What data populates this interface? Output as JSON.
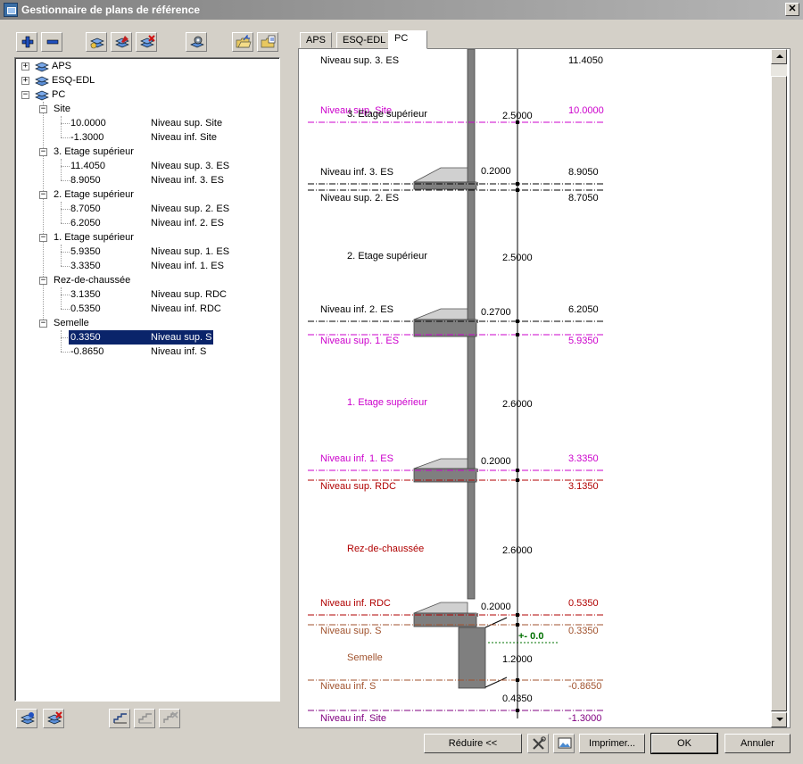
{
  "window": {
    "title": "Gestionnaire de plans de référence"
  },
  "toolbar": {
    "buttons": [
      "add-icon",
      "remove-icon",
      "layers-icon",
      "layers-edit-icon",
      "layers-delete-icon",
      "settings-icon",
      "folder-open-icon",
      "folder-export-icon"
    ]
  },
  "tree": {
    "projects": [
      "APS",
      "ESQ-EDL",
      "PC"
    ],
    "groups": [
      {
        "name": "Site",
        "rows": [
          {
            "value": "10.0000",
            "label": "Niveau sup. Site"
          },
          {
            "value": "-1.3000",
            "label": "Niveau inf. Site"
          }
        ]
      },
      {
        "name": "3. Etage supérieur",
        "rows": [
          {
            "value": "11.4050",
            "label": "Niveau sup. 3. ES"
          },
          {
            "value": "8.9050",
            "label": "Niveau inf. 3. ES"
          }
        ]
      },
      {
        "name": "2. Etage supérieur",
        "rows": [
          {
            "value": "8.7050",
            "label": "Niveau sup. 2. ES"
          },
          {
            "value": "6.2050",
            "label": "Niveau inf. 2. ES"
          }
        ]
      },
      {
        "name": "1. Etage supérieur",
        "rows": [
          {
            "value": "5.9350",
            "label": "Niveau sup. 1. ES"
          },
          {
            "value": "3.3350",
            "label": "Niveau inf. 1. ES"
          }
        ]
      },
      {
        "name": "Rez-de-chaussée",
        "rows": [
          {
            "value": "3.1350",
            "label": "Niveau sup. RDC"
          },
          {
            "value": "0.5350",
            "label": "Niveau inf. RDC"
          }
        ]
      },
      {
        "name": "Semelle",
        "rows": [
          {
            "value": "0.3350",
            "label": "Niveau sup. S"
          },
          {
            "value": "-0.8650",
            "label": "Niveau inf. S"
          }
        ]
      }
    ]
  },
  "tabs": [
    "APS",
    "ESQ-EDL",
    "PC"
  ],
  "active_tab": "PC",
  "diagram": {
    "colors": {
      "black": "#000000",
      "magenta": "#cc00cc",
      "red": "#b00000",
      "brown": "#a0522d",
      "purple": "#800080",
      "green": "#007000",
      "wall": "#7f7f7f",
      "slab_top": "#d0d0d0"
    },
    "top_label": {
      "left": "Niveau sup. 3. ES",
      "right": "11.4050"
    },
    "levels": [
      {
        "name": "Niveau sup. Site",
        "value": "10.0000",
        "color": "magenta"
      },
      {
        "name": "Niveau inf. 3. ES",
        "value": "8.9050",
        "color": "black"
      },
      {
        "name": "Niveau sup. 2. ES",
        "value": "8.7050",
        "color": "black"
      },
      {
        "name": "Niveau inf. 2. ES",
        "value": "6.2050",
        "color": "black"
      },
      {
        "name": "Niveau sup. 1. ES",
        "value": "5.9350",
        "color": "magenta"
      },
      {
        "name": "Niveau inf. 1. ES",
        "value": "3.3350",
        "color": "magenta"
      },
      {
        "name": "Niveau sup. RDC",
        "value": "3.1350",
        "color": "red"
      },
      {
        "name": "Niveau inf. RDC",
        "value": "0.5350",
        "color": "red"
      },
      {
        "name": "Niveau sup. S",
        "value": "0.3350",
        "color": "brown"
      },
      {
        "name": "Niveau inf. S",
        "value": "-0.8650",
        "color": "brown"
      },
      {
        "name": "Niveau inf. Site",
        "value": "-1.3000",
        "color": "purple"
      }
    ],
    "storeys": [
      {
        "name": "3. Etage supérieur",
        "height": "2.5000",
        "color": "black"
      },
      {
        "name": "2. Etage supérieur",
        "height": "2.5000",
        "color": "black"
      },
      {
        "name": "1. Etage supérieur",
        "height": "2.6000",
        "color": "magenta"
      },
      {
        "name": "Rez-de-chaussée",
        "height": "2.6000",
        "color": "red"
      },
      {
        "name": "Semelle",
        "height": "1.2000",
        "color": "brown"
      }
    ],
    "slab_thicknesses": [
      "0.2000",
      "0.2700",
      "0.2000",
      "0.2000"
    ],
    "foundation_gap": "0.4350",
    "zero_label": "+- 0.0"
  },
  "buttons": {
    "reduce": "Réduire <<",
    "print": "Imprimer...",
    "ok": "OK",
    "cancel": "Annuler"
  }
}
